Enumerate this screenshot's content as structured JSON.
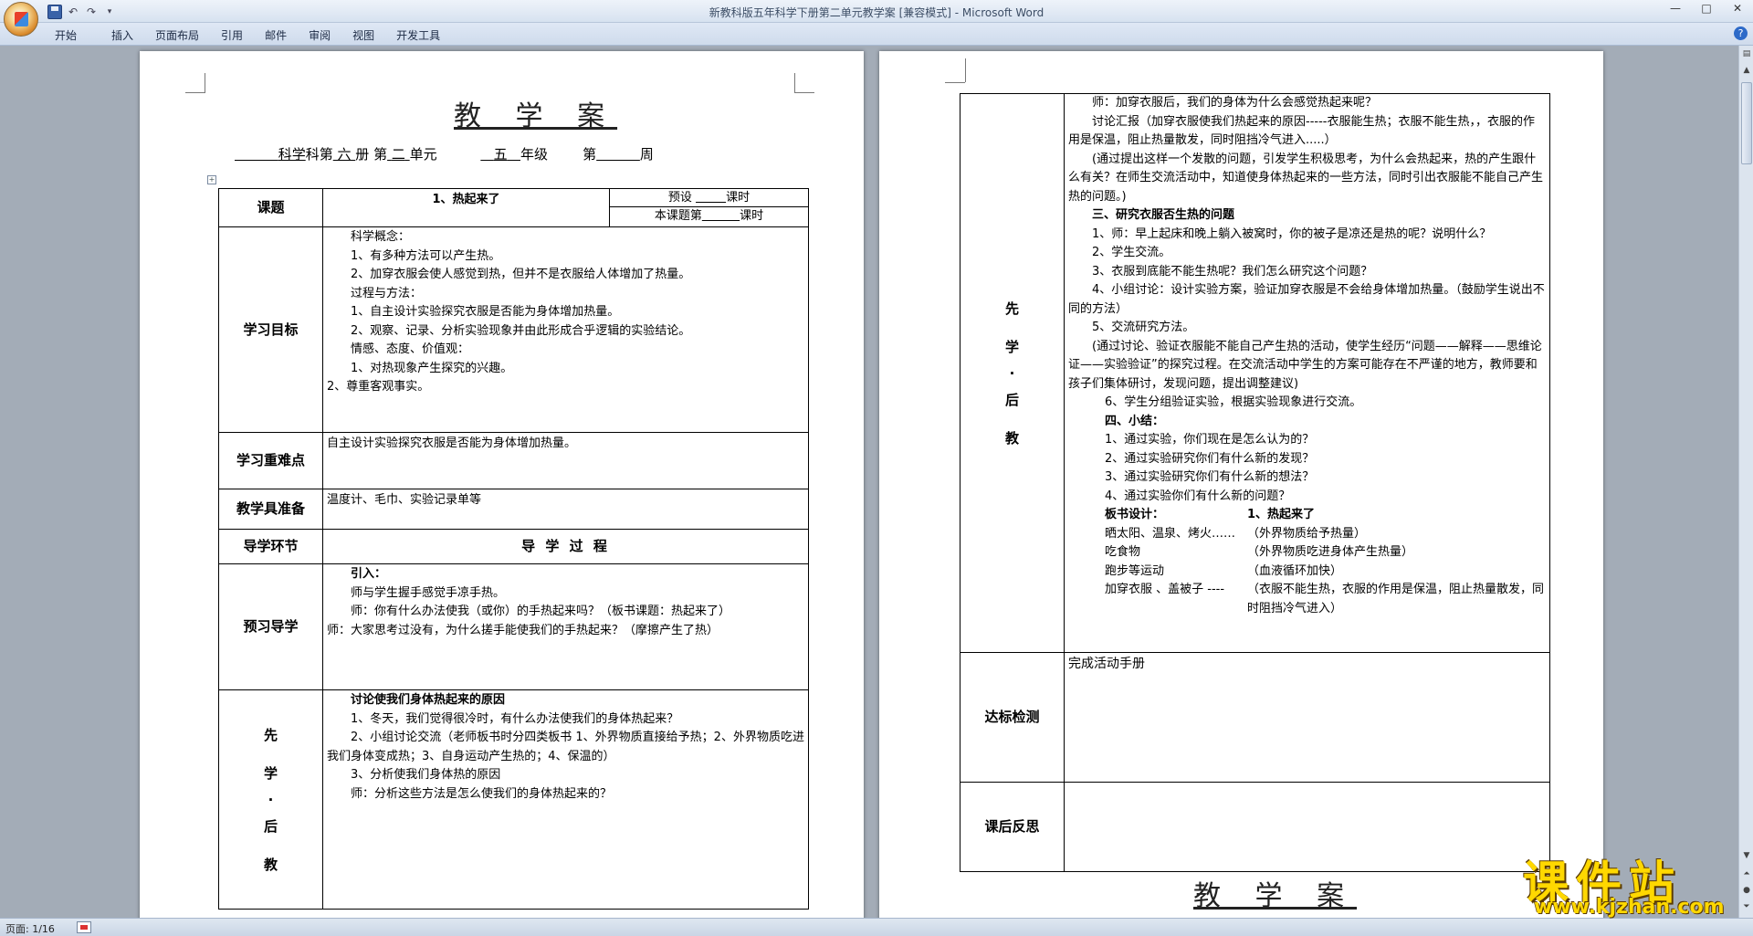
{
  "window": {
    "title": "新教科版五年科学下册第二单元教学案 [兼容模式] - Microsoft Word",
    "tabs": [
      "开始",
      "插入",
      "页面布局",
      "引用",
      "邮件",
      "审阅",
      "视图",
      "开发工具"
    ],
    "controls": {
      "minimize": "—",
      "maximize": "□",
      "close": "✕"
    },
    "help": "?"
  },
  "status": {
    "page": "页面: 1/16"
  },
  "page1": {
    "title": "教 学 案",
    "subline": {
      "subject": "科学",
      "subject_suffix": "科第",
      "volume": "六",
      "volume_suffix": "册 第",
      "unit": "二",
      "unit_suffix": "单元",
      "grade": "五",
      "grade_suffix": "年级",
      "week_prefix": "第",
      "week_suffix": "周"
    },
    "topic_label": "课题",
    "topic": "1、热起来了",
    "preset_label": "预设",
    "preset_unit": "课时",
    "lesson_label": "本课题第",
    "lesson_unit": "课时",
    "goals_label": "学习目标",
    "goals": [
      "科学概念：",
      "1、有多种方法可以产生热。",
      "2、加穿衣服会使人感觉到热，但并不是衣服给人体增加了热量。",
      "过程与方法：",
      "1、自主设计实验探究衣服是否能为身体增加热量。",
      "2、观察、记录、分析实验现象并由此形成合乎逻辑的实验结论。",
      "情感、态度、价值观：",
      "1、对热现象产生探究的兴趣。",
      "2、尊重客观事实。"
    ],
    "key_label": "学习重难点",
    "key_text": "自主设计实验探究衣服是否能为身体增加热量。",
    "prep_label": "教学具准备",
    "prep_text": "温度计、毛巾、实验记录单等",
    "section_label": "导学环节",
    "process_title": "导 学 过 程",
    "preview_label": "预习导学",
    "preview": [
      "引入：",
      "师与学生握手感觉手凉手热。",
      "师：你有什么办法使我（或你）的手热起来吗？（板书课题：热起来了）",
      "师：大家思考过没有，为什么搓手能使我们的手热起来？（摩擦产生了热）"
    ],
    "learn_label": [
      "先",
      "学",
      "·",
      "后",
      "教"
    ],
    "learn": [
      "讨论使我们身体热起来的原因",
      "1、冬天，我们觉得很冷时，有什么办法使我们的身体热起来？",
      "2、小组讨论交流（老师板书时分四类板书 1、外界物质直接给予热；2、外界物质吃进我们身体变成热；3、自身运动产生热的；4、保温的）",
      "3、分析使我们身体热的原因",
      "师：分析这些方法是怎么使我们的身体热起来的？"
    ]
  },
  "page2": {
    "learn_label": [
      "先",
      "学",
      "·",
      "后",
      "教"
    ],
    "content": [
      "师：加穿衣服后，我们的身体为什么会感觉热起来呢？",
      "讨论汇报（加穿衣服使我们热起来的原因-----衣服能生热；衣服不能生热，，衣服的作用是保温，阻止热量散发，同时阻挡冷气进入.....）",
      "(通过提出这样一个发散的问题，引发学生积极思考，为什么会热起来，热的产生跟什么有关？在师生交流活动中，知道使身体热起来的一些方法，同时引出衣服能不能自己产生热的问题。)",
      "三、研究衣服否生热的问题",
      "1、师：早上起床和晚上躺入被窝时，你的被子是凉还是热的呢？说明什么？",
      "2、学生交流。",
      "3、衣服到底能不能生热呢？我们怎么研究这个问题？",
      "4、小组讨论：设计实验方案，验证加穿衣服是不会给身体增加热量。（鼓励学生说出不同的方法）",
      "5、交流研究方法。",
      "(通过讨论、验证衣服能不能自己产生热的活动，使学生经历“问题——解释——思维论证——实验验证”的探究过程。在交流活动中学生的方案可能存在不严谨的地方，教师要和孩子们集体研讨，发现问题，提出调整建议)",
      "6、学生分组验证实验，根据实验现象进行交流。",
      "四、小结：",
      "1、通过实验，你们现在是怎么认为的？",
      "2、通过实验研究你们有什么新的发现？",
      "3、通过实验研究你们有什么新的想法？",
      "4、通过实验你们有什么新的问题？"
    ],
    "board_label": "板书设计：",
    "board_title": "1、热起来了",
    "board_rows": [
      {
        "left": "晒太阳、温泉、烤火……",
        "right": "（外界物质给予热量）"
      },
      {
        "left": "吃食物",
        "right": "（外界物质吃进身体产生热量）"
      },
      {
        "left": "跑步等运动",
        "right": "（血液循环加快）"
      },
      {
        "left": "加穿衣服 、盖被子 ----",
        "right": "（衣服不能生热，衣服的作用是保温，阻止热量散发，同时阻挡冷气进入）"
      }
    ],
    "check_label": "达标检测",
    "check_text": "完成活动手册",
    "reflect_label": "课后反思",
    "next_title": "教 学 案"
  },
  "watermark": {
    "brand": "课件站",
    "url": "www.kjzhan.com",
    "color": "#ffd800"
  }
}
